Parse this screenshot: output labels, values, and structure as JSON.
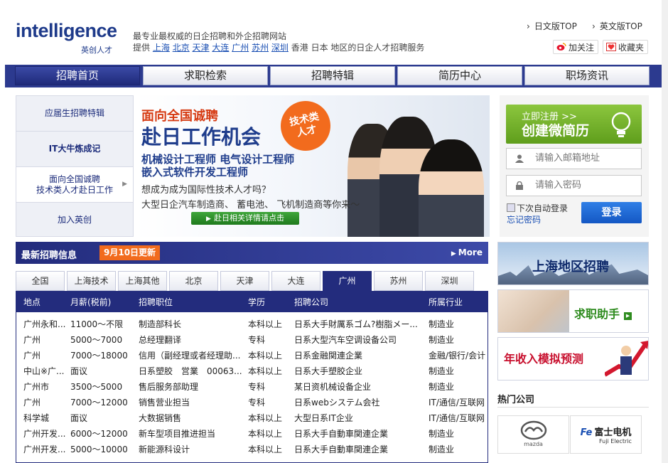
{
  "header": {
    "logo_word_i": "i",
    "logo_word_rest": "ntelligence",
    "logo_sub": "英创人才",
    "tagline1": "最专业最权威的日企招聘和外企招聘网站",
    "tagline2_prefix": "提供",
    "cities": [
      "上海",
      "北京",
      "天津",
      "大连",
      "广州",
      "苏州",
      "深圳"
    ],
    "tagline2_suffix": "香港 日本 地区的日企人才招聘服务",
    "link_jp": "日文版TOP",
    "link_en": "英文版TOP",
    "follow": "加关注",
    "favorite": "收藏夹"
  },
  "nav": {
    "tabs": [
      "招聘首页",
      "求职检索",
      "招聘特辑",
      "简历中心",
      "职场资讯"
    ]
  },
  "left_menu": {
    "items": [
      {
        "line1": "应届生招聘特辑",
        "line2": ""
      },
      {
        "line1": "IT大牛炼成记",
        "line2": ""
      },
      {
        "line1": "面向全国诚聘",
        "line2": "技术类人才赴日工作"
      },
      {
        "line1": "加入英创",
        "line2": ""
      }
    ]
  },
  "banner": {
    "l1": "面向全国诚聘",
    "l2": "赴日工作机会",
    "l3": "机械设计工程师 电气设计工程师",
    "l4": "嵌入式软件开发工程师",
    "l5": "想成为成为国际性技术人才吗？",
    "l6": "大型日企汽车制造商、 蓄电池、 飞机制造商等你来～",
    "badge1": "技术类",
    "badge2": "人才",
    "button": "赴日相关详情请点击"
  },
  "login": {
    "reg_small": "立即注册 >>",
    "reg_big": "创建微简历",
    "email_placeholder": "请输入邮箱地址",
    "password_placeholder": "请输入密码",
    "remember": "下次自动登录",
    "forgot": "忘记密码",
    "submit": "登录"
  },
  "jobs": {
    "title": "最新招聘信息",
    "date_badge": "9月10日更新",
    "more": "More",
    "city_tabs": [
      "全国",
      "上海技术",
      "上海其他",
      "北京",
      "天津",
      "大连",
      "广州",
      "苏州",
      "深圳"
    ],
    "active_city": "广州",
    "headers": [
      "地点",
      "月薪(税前)",
      "招聘职位",
      "学历",
      "招聘公司",
      "所属行业"
    ],
    "rows": [
      [
        "广州永和...",
        "11000～不限",
        "制造部科长",
        "本科以上",
        "日系大手財厲系ゴム?樹脂メー...",
        "制造业"
      ],
      [
        "广州",
        "5000～7000",
        "总经理翻译",
        "专科",
        "日系大型汽车空调设备公司",
        "制造业"
      ],
      [
        "广州",
        "7000～18000",
        "信用（副经理或者经理助...",
        "本科以上",
        "日系金融関連企業",
        "金融/银行/会计"
      ],
      [
        "中山※广...",
        "面议",
        "日系塑胶　営業　00063...",
        "本科以上",
        "日系大手塑胶企业",
        "制造业"
      ],
      [
        "广州市",
        "3500～5000",
        "售后服务部助理",
        "专科",
        "某日资机械设备企业",
        "制造业"
      ],
      [
        "广州",
        "7000～12000",
        "销售营业担当",
        "专科",
        "日系webシステム会社",
        "IT/通信/互联网"
      ],
      [
        "科学城",
        "面议",
        "大数据销售",
        "本科以上",
        "大型日系IT企业",
        "IT/通信/互联网"
      ],
      [
        "广州开发...",
        "6000～12000",
        "新车型项目推进担当",
        "本科以上",
        "日系大手自動車関連企業",
        "制造业"
      ],
      [
        "广州开发...",
        "5000～10000",
        "新能源科设计",
        "本科以上",
        "日系大手自動車関連企業",
        "制造业"
      ]
    ]
  },
  "right": {
    "banner_shanghai": "上海地区招聘",
    "banner_assistant": "求职助手",
    "banner_income": "年收入模拟预测",
    "hot_title": "热门公司",
    "company1": "mazda",
    "company2_cn": "富士电机",
    "company2_en": "Fuji Electric"
  },
  "colors": {
    "navy": "#232c7d",
    "orange": "#f26b1d",
    "green": "#6aab23",
    "blue": "#1a4fb3"
  }
}
